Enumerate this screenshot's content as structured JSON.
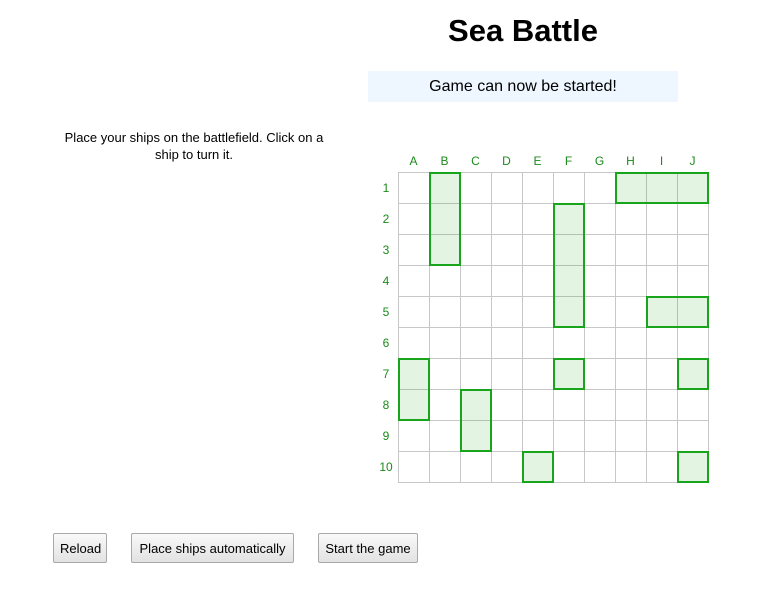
{
  "header": {
    "title": "Sea Battle",
    "status": "Game can now be started!"
  },
  "instructions": "Place your ships on the battlefield. Click on a ship to turn it.",
  "board": {
    "columns": [
      "A",
      "B",
      "C",
      "D",
      "E",
      "F",
      "G",
      "H",
      "I",
      "J"
    ],
    "rows": [
      "1",
      "2",
      "3",
      "4",
      "5",
      "6",
      "7",
      "8",
      "9",
      "10"
    ],
    "ships": [
      {
        "col": "B",
        "row": 1,
        "length": 3,
        "orientation": "vertical"
      },
      {
        "col": "H",
        "row": 1,
        "length": 3,
        "orientation": "horizontal"
      },
      {
        "col": "F",
        "row": 2,
        "length": 4,
        "orientation": "vertical"
      },
      {
        "col": "I",
        "row": 5,
        "length": 2,
        "orientation": "horizontal"
      },
      {
        "col": "A",
        "row": 7,
        "length": 2,
        "orientation": "vertical"
      },
      {
        "col": "F",
        "row": 7,
        "length": 1,
        "orientation": "horizontal"
      },
      {
        "col": "J",
        "row": 7,
        "length": 1,
        "orientation": "horizontal"
      },
      {
        "col": "C",
        "row": 8,
        "length": 2,
        "orientation": "vertical"
      },
      {
        "col": "E",
        "row": 10,
        "length": 1,
        "orientation": "horizontal"
      },
      {
        "col": "J",
        "row": 10,
        "length": 1,
        "orientation": "horizontal"
      }
    ],
    "colors": {
      "ship_border": "#18a51c",
      "label": "#1b8a1b",
      "grid_line": "#c7c7c7",
      "status_bg": "#eef6ff"
    }
  },
  "buttons": {
    "reload": "Reload",
    "auto_place": "Place ships automatically",
    "start": "Start the game"
  }
}
